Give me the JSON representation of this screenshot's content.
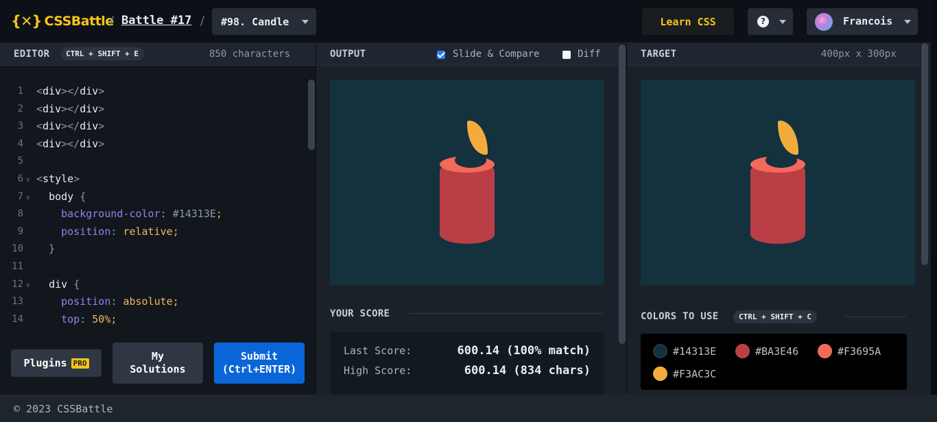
{
  "header": {
    "logo_mark": "{✕}",
    "logo_text": "CSSBattle",
    "separator": "/",
    "battle_label": "Battle #17",
    "target_select": "#98. Candle",
    "learn_label": "Learn CSS",
    "help_glyph": "?",
    "user_name": "Francois"
  },
  "editor": {
    "title": "EDITOR",
    "shortcut": "CTRL + SHIFT + E",
    "char_count": "850 characters",
    "lines": [
      {
        "n": "1",
        "fold": false
      },
      {
        "n": "2",
        "fold": false
      },
      {
        "n": "3",
        "fold": false
      },
      {
        "n": "4",
        "fold": false
      },
      {
        "n": "5",
        "fold": false
      },
      {
        "n": "6",
        "fold": true
      },
      {
        "n": "7",
        "fold": true
      },
      {
        "n": "8",
        "fold": false
      },
      {
        "n": "9",
        "fold": false
      },
      {
        "n": "10",
        "fold": false
      },
      {
        "n": "11",
        "fold": false
      },
      {
        "n": "12",
        "fold": true
      },
      {
        "n": "13",
        "fold": false
      },
      {
        "n": "14",
        "fold": false
      }
    ],
    "code": {
      "div_tag": "div",
      "style_tag": "style",
      "body_sel": "body",
      "div_sel": "div",
      "l8_prop": "background-color",
      "l8_val": "#14313E",
      "l9_prop": "position",
      "l9_val": "relative",
      "l13_prop": "position",
      "l13_val": "absolute",
      "l14_prop": "top",
      "l14_val": "50%"
    },
    "plugins_label": "Plugins",
    "pro_badge": "PRO",
    "my_solutions_line1": "My",
    "my_solutions_line2": "Solutions",
    "submit_line1": "Submit",
    "submit_line2": "(Ctrl+ENTER)"
  },
  "output": {
    "title": "OUTPUT",
    "slide_compare_label": "Slide & Compare",
    "slide_compare_checked": true,
    "diff_label": "Diff",
    "diff_checked": false,
    "score_title": "YOUR SCORE",
    "last_score_label": "Last Score:",
    "last_score_value": "600.14 (100% match)",
    "high_score_label": "High Score:",
    "high_score_value": "600.14 (834 chars)"
  },
  "target": {
    "title": "TARGET",
    "size": "400px x 300px",
    "colors_title": "COLORS TO USE",
    "colors_shortcut": "CTRL + SHIFT + C",
    "colors": [
      {
        "hex": "#14313E"
      },
      {
        "hex": "#BA3E46"
      },
      {
        "hex": "#F3695A"
      },
      {
        "hex": "#F3AC3C"
      }
    ]
  },
  "footer": {
    "copyright": "© 2023 CSSBattle"
  }
}
